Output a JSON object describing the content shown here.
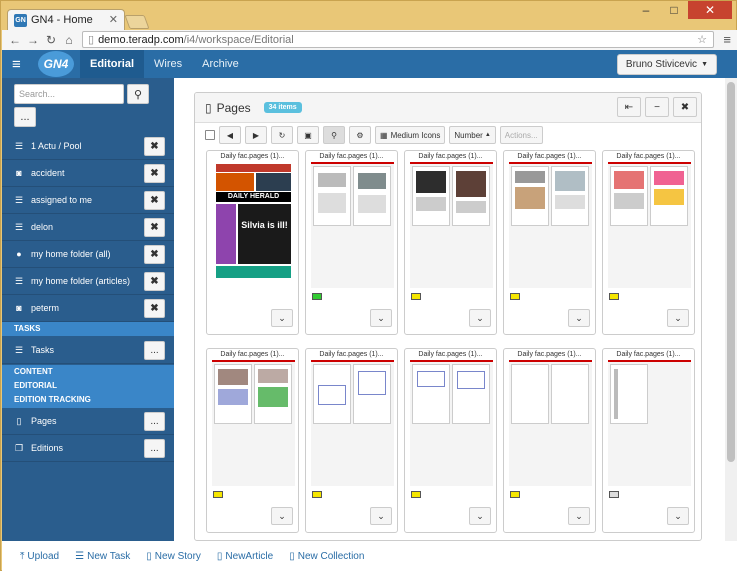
{
  "browser": {
    "tab_title": "GN4 - Home",
    "favicon_text": "GN",
    "url_domain": "demo.teradp.com",
    "url_path": "/i4/workspace/Editorial"
  },
  "header": {
    "logo": "GN4",
    "tabs": [
      {
        "label": "Editorial",
        "active": true
      },
      {
        "label": "Wires",
        "active": false
      },
      {
        "label": "Archive",
        "active": false
      }
    ],
    "user": "Bruno Stivicevic"
  },
  "sidebar": {
    "search_placeholder": "Search...",
    "more_label": "...",
    "items": [
      {
        "label": "1 Actu / Pool",
        "icon": "list-icon"
      },
      {
        "label": "accident",
        "icon": "camera-icon"
      },
      {
        "label": "assigned to me",
        "icon": "list-icon"
      },
      {
        "label": "delon",
        "icon": "list-icon"
      },
      {
        "label": "my home folder (all)",
        "icon": "globe-icon"
      },
      {
        "label": "my home folder (articles)",
        "icon": "list-icon"
      },
      {
        "label": "peterm",
        "icon": "camera-icon"
      }
    ],
    "section_tasks": "TASKS",
    "tasks_item": "Tasks",
    "section_content": "CONTENT",
    "section_editorial": "EDITORIAL",
    "section_tracking": "EDITION TRACKING",
    "pages_item": "Pages",
    "editions_item": "Editions"
  },
  "panel": {
    "title": "Pages",
    "count_badge": "34 items",
    "view_mode": "Medium Icons",
    "sort": "Number",
    "actions": "Actions...",
    "cards": [
      {
        "title": "Daily fac.pages (1)...",
        "status_color": null
      },
      {
        "title": "Daily fac.pages (1)...",
        "status_color": "#33cc33"
      },
      {
        "title": "Daily fac.pages (1)...",
        "status_color": "#f5e600"
      },
      {
        "title": "Daily fac.pages (1)...",
        "status_color": "#f5e600"
      },
      {
        "title": "Daily fac.pages (1)...",
        "status_color": "#f5e600"
      },
      {
        "title": "Daily fac.pages (1)...",
        "status_color": "#f5e600"
      },
      {
        "title": "Daily fac.pages (1)...",
        "status_color": "#f5e600"
      },
      {
        "title": "Daily fac.pages (1)...",
        "status_color": "#f5e600"
      },
      {
        "title": "Daily fac.pages (1)...",
        "status_color": "#f5e600"
      },
      {
        "title": "Daily fac.pages (1)...",
        "status_color": "#dddddd"
      }
    ]
  },
  "footer": {
    "upload": "Upload",
    "new_task": "New Task",
    "new_story": "New Story",
    "new_article": "NewArticle",
    "new_collection": "New Collection"
  }
}
